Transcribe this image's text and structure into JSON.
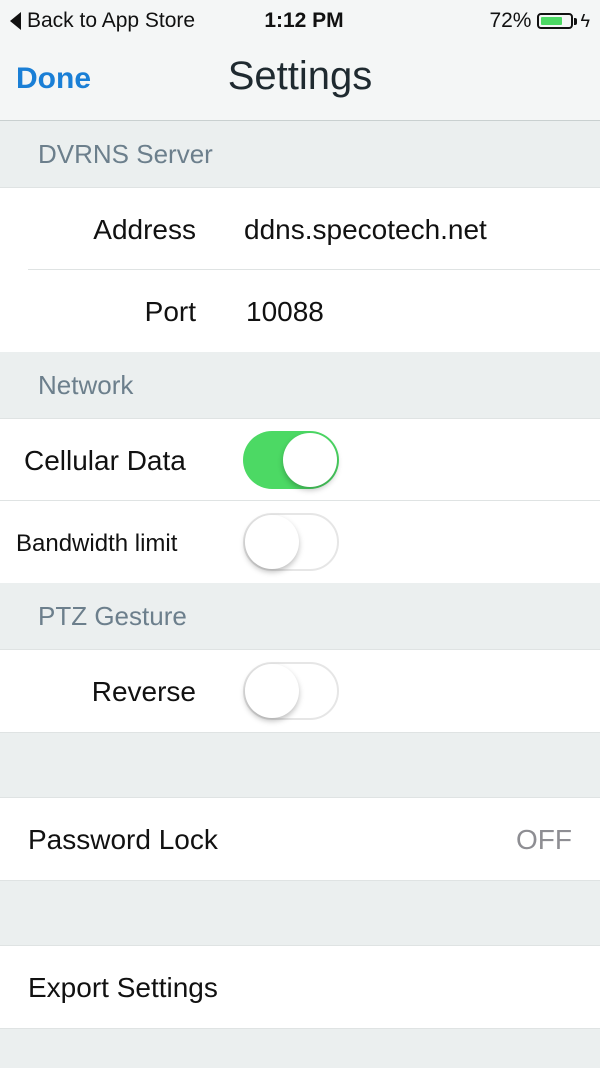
{
  "status_bar": {
    "back_label": "Back to App Store",
    "time": "1:12 PM",
    "battery_percent_text": "72%",
    "battery_level": 0.72,
    "charging_symbol": "ϟ"
  },
  "nav": {
    "done_label": "Done",
    "title": "Settings"
  },
  "dvrns": {
    "header": "DVRNS Server",
    "address_label": "Address",
    "address_value": "ddns.specotech.net",
    "port_label": "Port",
    "port_value": "10088"
  },
  "network": {
    "header": "Network",
    "cellular_label": "Cellular Data",
    "cellular_on": true,
    "bandwidth_label": "Bandwidth limit",
    "bandwidth_on": false
  },
  "ptz": {
    "header": "PTZ Gesture",
    "reverse_label": "Reverse",
    "reverse_on": false
  },
  "password_lock": {
    "label": "Password Lock",
    "value": "OFF"
  },
  "export": {
    "label": "Export Settings"
  },
  "colors": {
    "accent": "#1a7fd6",
    "toggle_on": "#4cd964",
    "section_text": "#6c7f8c",
    "background": "#ebefef"
  }
}
